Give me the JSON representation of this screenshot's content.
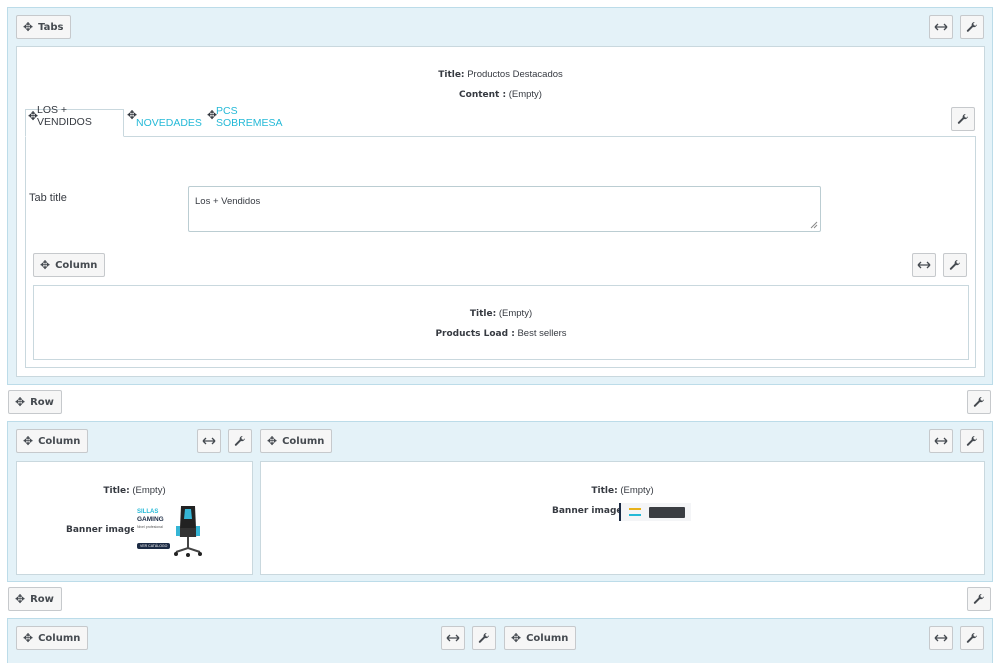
{
  "tabs_block": {
    "move_label": "Tabs",
    "title_key": "Title:",
    "title_value": "Productos Destacados",
    "content_key": "Content :",
    "content_value": "(Empty)",
    "tabs": [
      {
        "label": "LOS + VENDIDOS",
        "active": true
      },
      {
        "label": "NOVEDADES",
        "active": false
      },
      {
        "label": "PCS SOBREMESA",
        "active": false
      }
    ],
    "tab_title_label": "Tab title",
    "tab_title_value": "Los + Vendidos",
    "column": {
      "move_label": "Column",
      "title_key": "Title:",
      "title_value": "(Empty)",
      "products_key": "Products Load :",
      "products_value": "Best sellers"
    }
  },
  "row1": {
    "move_label": "Row"
  },
  "row1_columns": [
    {
      "move_label": "Column",
      "title_key": "Title:",
      "title_value": "(Empty)",
      "banner_key": "Banner image :",
      "banner_text": {
        "line1": "SILLAS",
        "line2": "GAMING",
        "line3": "Nivel profesional",
        "cta": "VER CATÁLOGO"
      }
    },
    {
      "move_label": "Column",
      "title_key": "Title:",
      "title_value": "(Empty)",
      "banner_key": "Banner image :"
    }
  ],
  "row2": {
    "move_label": "Row"
  },
  "row2_columns": [
    {
      "move_label": "Column"
    },
    {
      "move_label": "Column"
    }
  ],
  "icons": {
    "move": "move-icon",
    "resize": "arrows-horizontal-icon",
    "settings": "wrench-icon"
  },
  "colors": {
    "panel_bg": "#e4f2f8",
    "panel_border": "#bcdce9",
    "link": "#25b9d7"
  }
}
